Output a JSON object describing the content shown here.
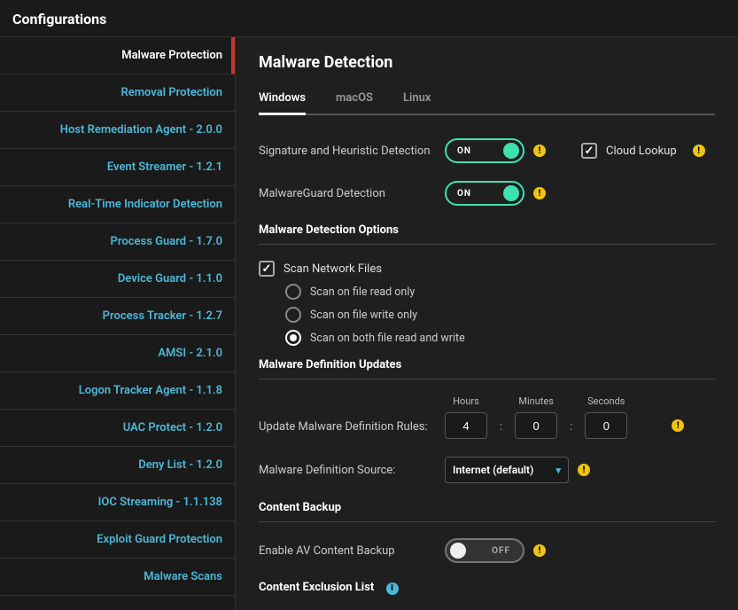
{
  "page_title": "Configurations",
  "sidebar": {
    "items": [
      {
        "label": "Malware Protection",
        "active": true
      },
      {
        "label": "Removal Protection"
      },
      {
        "label": "Host Remediation Agent - 2.0.0"
      },
      {
        "label": "Event Streamer - 1.2.1"
      },
      {
        "label": "Real-Time Indicator Detection"
      },
      {
        "label": "Process Guard - 1.7.0"
      },
      {
        "label": "Device Guard - 1.1.0"
      },
      {
        "label": "Process Tracker - 1.2.7"
      },
      {
        "label": "AMSI - 2.1.0"
      },
      {
        "label": "Logon Tracker Agent - 1.1.8"
      },
      {
        "label": "UAC Protect - 1.2.0"
      },
      {
        "label": "Deny List - 1.2.0"
      },
      {
        "label": "IOC Streaming - 1.1.138"
      },
      {
        "label": "Exploit Guard Protection"
      },
      {
        "label": "Malware Scans"
      }
    ]
  },
  "main": {
    "title": "Malware Detection",
    "tabs": [
      {
        "label": "Windows",
        "active": true
      },
      {
        "label": "macOS"
      },
      {
        "label": "Linux"
      }
    ],
    "signature_label": "Signature and Heuristic Detection",
    "signature_state": "ON",
    "cloud_lookup_label": "Cloud Lookup",
    "cloud_lookup_checked": true,
    "malwareguard_label": "MalwareGuard Detection",
    "malwareguard_state": "ON",
    "options_heading": "Malware Detection Options",
    "scan_network_label": "Scan Network Files",
    "scan_network_checked": true,
    "scan_options": [
      {
        "label": "Scan on file read only",
        "selected": false
      },
      {
        "label": "Scan on file write only",
        "selected": false
      },
      {
        "label": "Scan on both file read and write",
        "selected": true
      }
    ],
    "updates_heading": "Malware Definition Updates",
    "update_rules_label": "Update Malware Definition Rules:",
    "time_labels": {
      "hours": "Hours",
      "minutes": "Minutes",
      "seconds": "Seconds"
    },
    "time_values": {
      "hours": "4",
      "minutes": "0",
      "seconds": "0"
    },
    "source_label": "Malware Definition Source:",
    "source_value": "Internet (default)",
    "backup_heading": "Content Backup",
    "enable_backup_label": "Enable AV Content Backup",
    "enable_backup_state": "OFF",
    "exclusion_heading": "Content Exclusion List"
  }
}
